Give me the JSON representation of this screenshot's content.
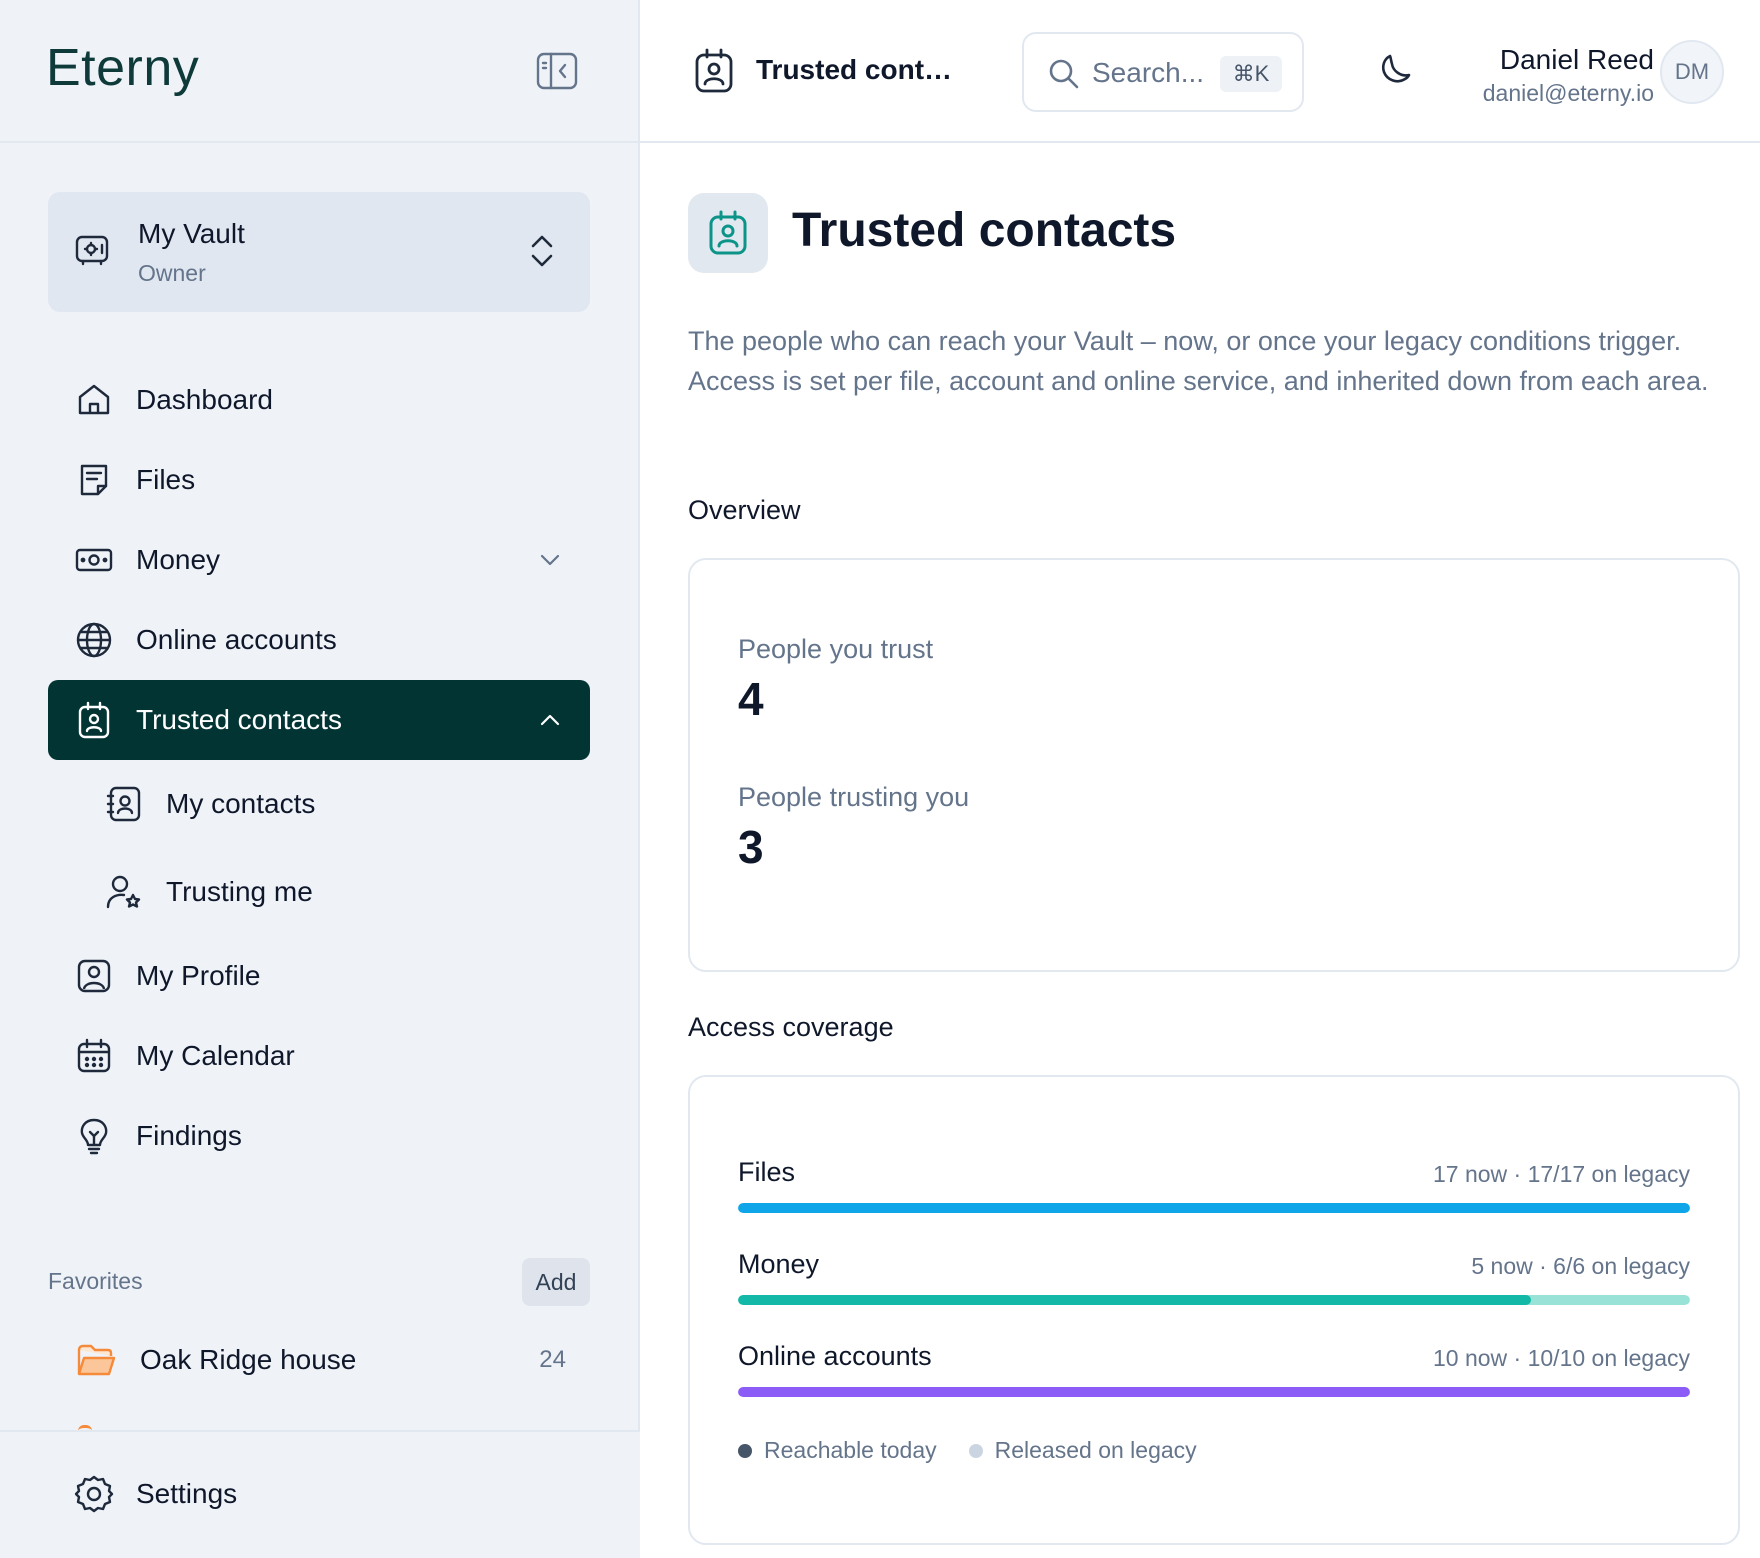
{
  "brand": {
    "logo_text": "Eterny"
  },
  "vault": {
    "name": "My Vault",
    "role": "Owner"
  },
  "nav": {
    "items": [
      {
        "label": "Dashboard"
      },
      {
        "label": "Files"
      },
      {
        "label": "Money"
      },
      {
        "label": "Online accounts"
      },
      {
        "label": "Trusted contacts"
      },
      {
        "label": "My contacts"
      },
      {
        "label": "Trusting me"
      },
      {
        "label": "My Profile"
      },
      {
        "label": "My Calendar"
      },
      {
        "label": "Findings"
      }
    ],
    "active": "Trusted contacts"
  },
  "favorites": {
    "title": "Favorites",
    "add_label": "Add",
    "items": [
      {
        "label": "Oak Ridge house",
        "count": "24"
      }
    ]
  },
  "settings": {
    "label": "Settings"
  },
  "header": {
    "title": "Trusted contacts",
    "search_placeholder": "Search...",
    "search_shortcut": "⌘K",
    "user_name": "Daniel Reed",
    "user_email": "daniel@eterny.io",
    "avatar_initials": "DM"
  },
  "page": {
    "title": "Trusted contacts",
    "description": "The people who can reach your Vault – now, or once your legacy conditions trigger. Access is set per file, account and online service, and inherited down from each area."
  },
  "overview": {
    "title": "Overview",
    "stats": [
      {
        "label": "People you trust",
        "value": "4"
      },
      {
        "label": "People trusting you",
        "value": "3"
      }
    ]
  },
  "coverage": {
    "title": "Access coverage",
    "rows": [
      {
        "name": "Files",
        "meta": "17 now · 17/17 on legacy",
        "now": 17,
        "legacy": 17,
        "total": 17,
        "color": "#0ea5e9",
        "light": "#bae6fd"
      },
      {
        "name": "Money",
        "meta": "5 now · 6/6 on legacy",
        "now": 5,
        "legacy": 6,
        "total": 6,
        "color": "#14b8a6",
        "light": "#99e2d8"
      },
      {
        "name": "Online accounts",
        "meta": "10 now · 10/10 on legacy",
        "now": 10,
        "legacy": 10,
        "total": 10,
        "color": "#8b5cf6",
        "light": "#ddd6fe"
      }
    ],
    "legend": [
      {
        "label": "Reachable today",
        "color": "#475569"
      },
      {
        "label": "Released on legacy",
        "color": "#cbd5e1"
      }
    ]
  },
  "colors": {
    "active_nav": "#033434",
    "accent_teal": "#0d9488",
    "folder_orange": "#f58a3a"
  }
}
